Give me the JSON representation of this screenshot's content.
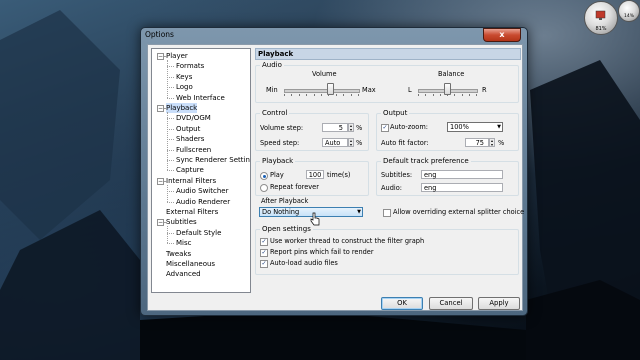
{
  "window": {
    "title": "Options",
    "close_glyph": "x"
  },
  "gadget": {
    "cpu": "81%",
    "mem": "14%"
  },
  "tree": {
    "items": [
      {
        "label": "Player",
        "level": 0
      },
      {
        "label": "Formats",
        "level": 1
      },
      {
        "label": "Keys",
        "level": 1
      },
      {
        "label": "Logo",
        "level": 1
      },
      {
        "label": "Web Interface",
        "level": 1
      },
      {
        "label": "Playback",
        "level": 0,
        "selected": true
      },
      {
        "label": "DVD/OGM",
        "level": 1
      },
      {
        "label": "Output",
        "level": 1
      },
      {
        "label": "Shaders",
        "level": 1
      },
      {
        "label": "Fullscreen",
        "level": 1
      },
      {
        "label": "Sync Renderer Settings",
        "level": 1
      },
      {
        "label": "Capture",
        "level": 1
      },
      {
        "label": "Internal Filters",
        "level": 0
      },
      {
        "label": "Audio Switcher",
        "level": 1
      },
      {
        "label": "Audio Renderer",
        "level": 1
      },
      {
        "label": "External Filters",
        "level": 0
      },
      {
        "label": "Subtitles",
        "level": 0
      },
      {
        "label": "Default Style",
        "level": 1
      },
      {
        "label": "Misc",
        "level": 1
      },
      {
        "label": "Tweaks",
        "level": 0
      },
      {
        "label": "Miscellaneous",
        "level": 0
      },
      {
        "label": "Advanced",
        "level": 0
      }
    ]
  },
  "page": {
    "header": "Playback",
    "audio": {
      "label": "Audio",
      "volume_label": "Volume",
      "min": "Min",
      "max": "Max",
      "volume_level": 0.62,
      "balance_label": "Balance",
      "left": "L",
      "right": "R",
      "balance_level": 0.5
    },
    "control": {
      "label": "Control",
      "volume_step_label": "Volume step:",
      "volume_step_value": "5",
      "volume_step_unit": "%",
      "speed_step_label": "Speed step:",
      "speed_step_value": "Auto",
      "speed_step_unit": "%"
    },
    "output": {
      "label": "Output",
      "auto_zoom_label": "Auto-zoom:",
      "auto_zoom_checked": true,
      "auto_zoom_value": "100%",
      "auto_fit_label": "Auto fit factor:",
      "auto_fit_value": "75",
      "auto_fit_unit": "%"
    },
    "playback": {
      "label": "Playback",
      "play_label": "Play",
      "play_times_value": "100",
      "times_label": "time(s)",
      "repeat_label": "Repeat forever",
      "selected": "play"
    },
    "after_playback": {
      "label": "After Playback",
      "value": "Do Nothing"
    },
    "default_track": {
      "label": "Default track preference",
      "subtitles_label": "Subtitles:",
      "subtitles_value": "eng",
      "audio_label": "Audio:",
      "audio_value": "eng"
    },
    "allow_override_label": "Allow overriding external splitter choice",
    "open_settings": {
      "label": "Open settings",
      "worker_label": "Use worker thread to construct the filter graph",
      "report_label": "Report pins which fail to render",
      "autoload_label": "Auto-load audio files"
    }
  },
  "buttons": {
    "ok": "OK",
    "cancel": "Cancel",
    "apply": "Apply"
  }
}
